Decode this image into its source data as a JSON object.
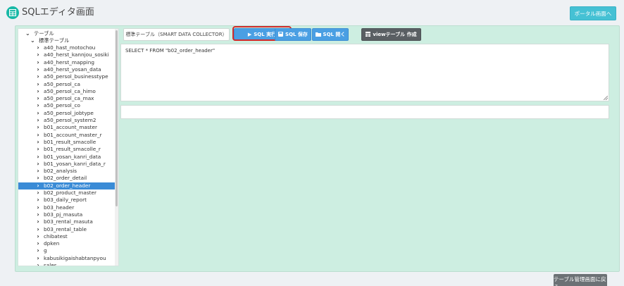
{
  "app": {
    "title": "SQLエディタ画面",
    "logo_icon": "table-icon"
  },
  "header": {
    "portal_button": "ポータル画面へ"
  },
  "toolbar": {
    "table_selector": "標準テーブル（SMART DATA COLLECTOR）",
    "run_label": "SQL 実行",
    "save_label": "SQL 保存",
    "open_label": "SQL 開く",
    "view_label": "viewテーブル 作成"
  },
  "editor": {
    "sql": "SELECT * FROM \"b02_order_header\""
  },
  "tree": {
    "root_label": "テーブル",
    "group_label": "標準テーブル",
    "selected": "b02_order_header",
    "items": [
      "a40_hast_motochou",
      "a40_herst_kannjou_sosiki",
      "a40_herst_mapping",
      "a40_herst_yosan_data",
      "a50_persol_businesstype",
      "a50_persol_ca",
      "a50_persol_ca_himo",
      "a50_persol_ca_max",
      "a50_persol_co",
      "a50_persol_jobtype",
      "a50_persol_system2",
      "b01_account_master",
      "b01_account_master_r",
      "b01_result_smacolle",
      "b01_result_smacolle_r",
      "b01_yosan_kanri_data",
      "b01_yosan_kanri_data_r",
      "b02_analysis",
      "b02_order_detail",
      "b02_order_header",
      "b02_product_master",
      "b03_daily_report",
      "b03_header",
      "b03_pj_masuta",
      "b03_rental_masuta",
      "b03_rental_table",
      "chibatest",
      "dpken",
      "g",
      "kabusikigaishabtanpyou",
      "sales"
    ]
  },
  "footer": {
    "back_button": "テーブル管理画面に戻る"
  },
  "colors": {
    "accent": "#17b8a6",
    "panel": "#cdeee1",
    "selected": "#3a8bd6",
    "highlight": "#d12b2b"
  }
}
